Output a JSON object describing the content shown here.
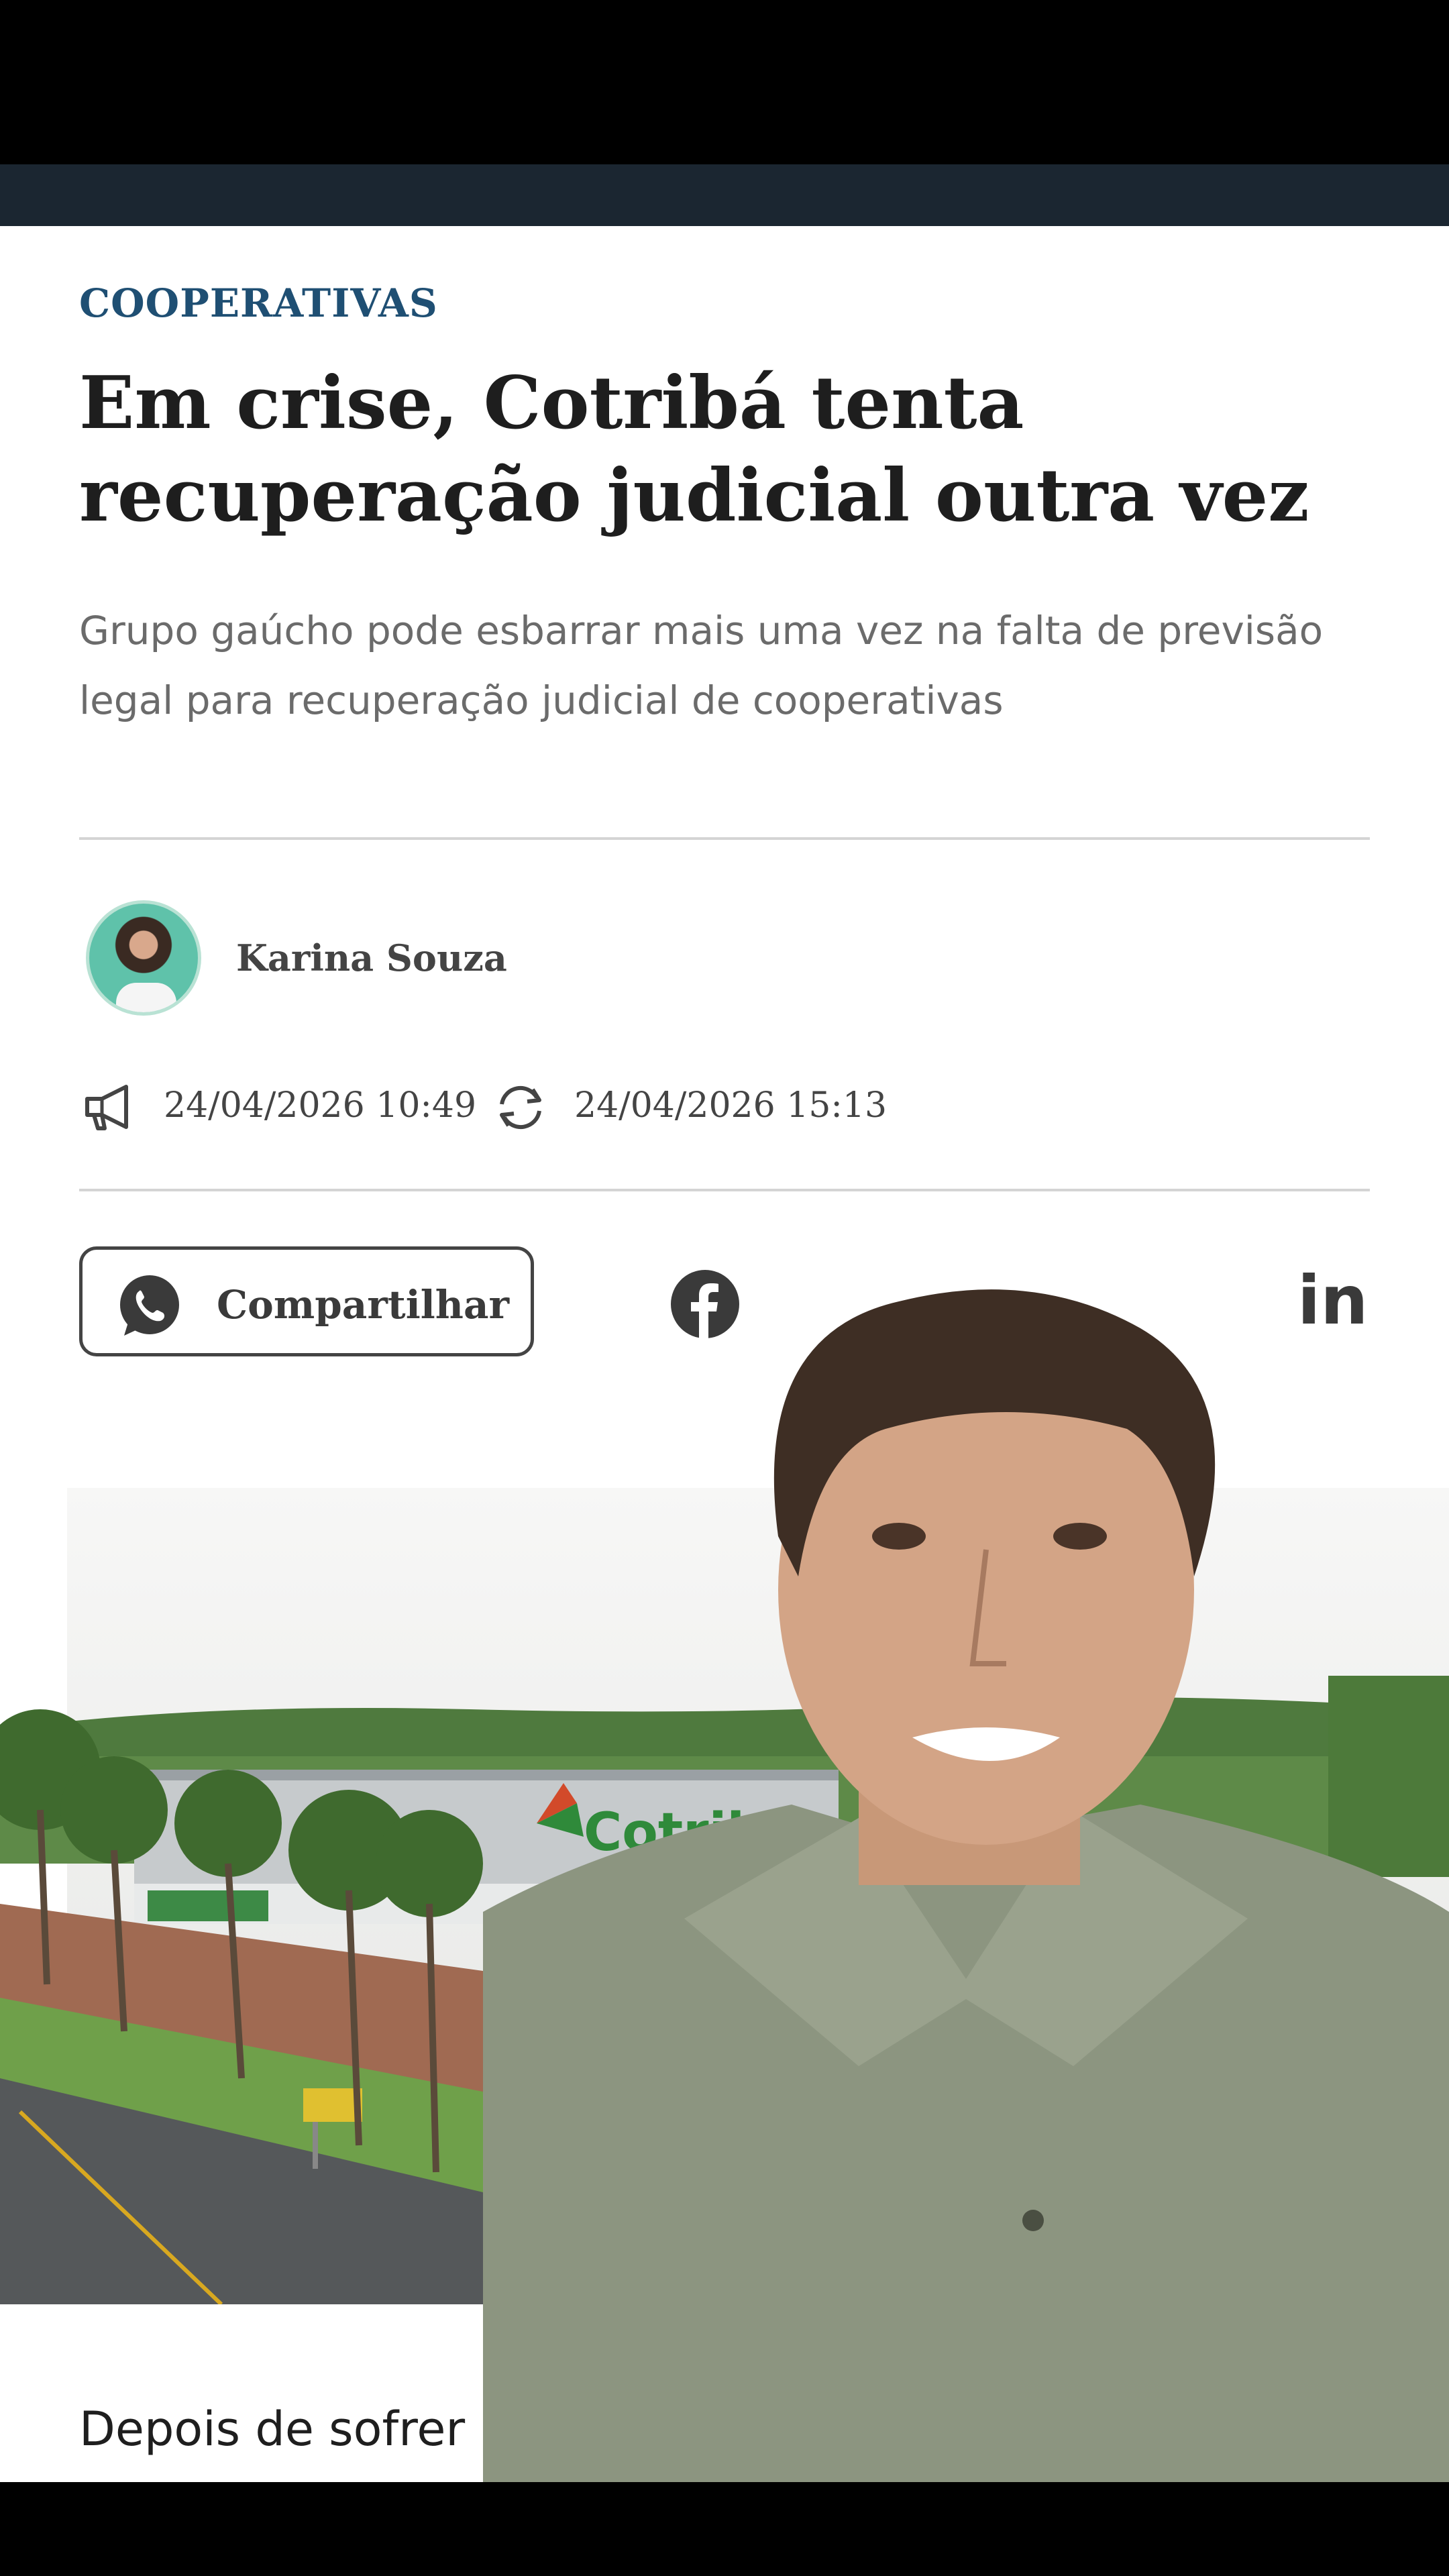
{
  "article": {
    "kicker": "COOPERATIVAS",
    "headline": "Em crise, Cotribá tenta recuperação judicial outra vez",
    "subtitle": "Grupo gaúcho pode esbarrar mais uma vez na falta de previsão legal para recuperação judicial de cooperativas",
    "author": "Karina Souza",
    "published": "24/04/2026 10:49",
    "updated": "24/04/2026 15:13",
    "body_start": "Depois de sofrer u"
  },
  "share": {
    "whatsapp_label": "Compartilhar"
  },
  "image": {
    "sign_text": "Cotrib"
  },
  "icons": {
    "published": "megaphone-icon",
    "updated": "refresh-icon",
    "whatsapp": "whatsapp-icon",
    "facebook": "facebook-icon",
    "linkedin": "linkedin-icon"
  },
  "colors": {
    "kicker": "#1f4f73",
    "nav_bar": "#1b2631",
    "headline": "#1e1e1e",
    "cotriba_green": "#2f8a3a"
  }
}
